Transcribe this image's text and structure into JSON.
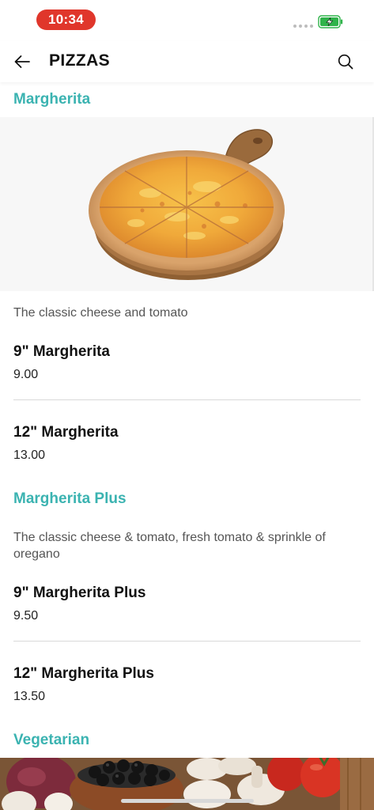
{
  "status_bar": {
    "time": "10:34",
    "battery_color": "#2fb34a",
    "time_pill_color": "#e0362b"
  },
  "header": {
    "back_icon": "arrow-left-icon",
    "title": "PIZZAS",
    "search_icon": "search-icon"
  },
  "colors": {
    "accent": "#3bb3b1"
  },
  "sections": [
    {
      "title": "Margherita",
      "description": "The classic cheese and tomato",
      "items": [
        {
          "name": "9\" Margherita",
          "price": "9.00"
        },
        {
          "name": "12\" Margherita",
          "price": "13.00"
        }
      ]
    },
    {
      "title": "Margherita Plus",
      "description": "The classic cheese & tomato, fresh tomato & sprinkle of oregano",
      "items": [
        {
          "name": "9\" Margherita Plus",
          "price": "9.50"
        },
        {
          "name": "12\" Margherita Plus",
          "price": "13.50"
        }
      ]
    },
    {
      "title": "Vegetarian"
    }
  ]
}
